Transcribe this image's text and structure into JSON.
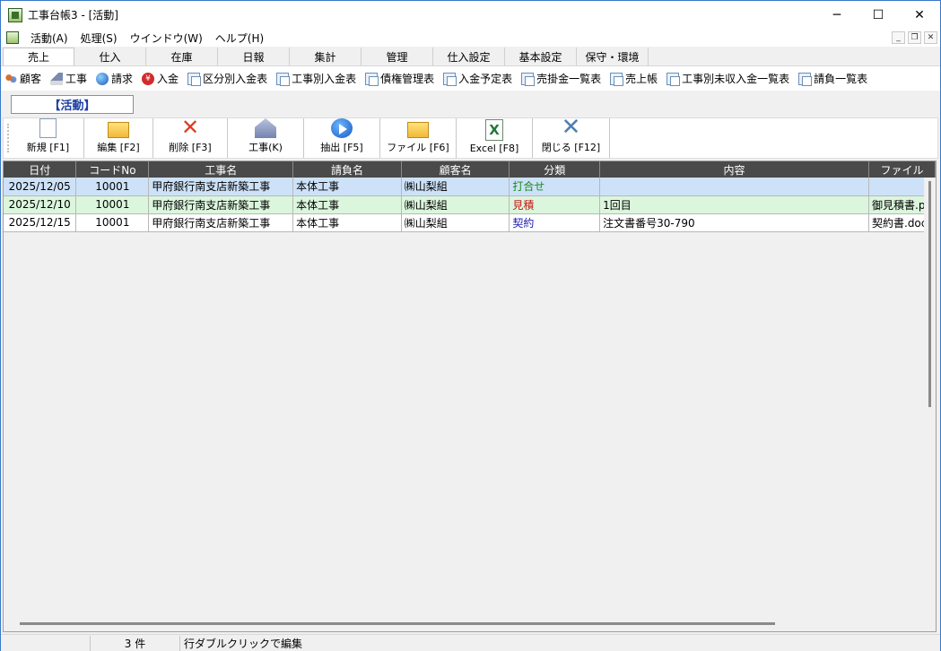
{
  "window": {
    "title": "工事台帳3 - [活動]",
    "minimize": "─",
    "maximize": "☐",
    "close": "✕"
  },
  "menu": [
    {
      "label": "活動(A)"
    },
    {
      "label": "処理(S)"
    },
    {
      "label": "ウインドウ(W)"
    },
    {
      "label": "ヘルプ(H)"
    }
  ],
  "mdi_controls": {
    "minimize": "_",
    "restore": "❐",
    "close": "✕"
  },
  "tabs": [
    {
      "label": "売上"
    },
    {
      "label": "仕入"
    },
    {
      "label": "在庫"
    },
    {
      "label": "日報"
    },
    {
      "label": "集計"
    },
    {
      "label": "管理"
    },
    {
      "label": "仕入設定"
    },
    {
      "label": "基本設定"
    },
    {
      "label": "保守・環境"
    }
  ],
  "subtoolbar": [
    {
      "label": "顧客",
      "icon": "people-icon"
    },
    {
      "label": "工事",
      "icon": "house-icon"
    },
    {
      "label": "請求",
      "icon": "globe-icon"
    },
    {
      "label": "入金",
      "icon": "yen-icon"
    },
    {
      "label": "区分別入金表",
      "icon": "document-icon"
    },
    {
      "label": "工事別入金表",
      "icon": "document-icon"
    },
    {
      "label": "債権管理表",
      "icon": "document-icon"
    },
    {
      "label": "入金予定表",
      "icon": "document-icon"
    },
    {
      "label": "売掛金一覧表",
      "icon": "document-icon"
    },
    {
      "label": "売上帳",
      "icon": "document-icon"
    },
    {
      "label": "工事別未収入金一覧表",
      "icon": "document-icon"
    },
    {
      "label": "請負一覧表",
      "icon": "document-icon"
    }
  ],
  "heading": "【活動】",
  "toolbar": {
    "new": "新規 [F1]",
    "edit": "編集 [F2]",
    "delete": "削除 [F3]",
    "project": "工事(K)",
    "extract": "抽出 [F5]",
    "file": "ファイル [F6]",
    "excel": "Excel [F8]",
    "close": "閉じる [F12]",
    "excel_glyph": "X"
  },
  "grid": {
    "columns": [
      "日付",
      "コードNo",
      "工事名",
      "請負名",
      "顧客名",
      "分類",
      "内容",
      "ファイル"
    ],
    "rows": [
      {
        "date": "2025/12/05",
        "code": "10001",
        "project": "甲府銀行南支店新築工事",
        "contract": "本体工事",
        "customer": "㈱山梨組",
        "category": "打合せ",
        "category_color": "#1a8a1a",
        "content": "",
        "file": ""
      },
      {
        "date": "2025/12/10",
        "code": "10001",
        "project": "甲府銀行南支店新築工事",
        "contract": "本体工事",
        "customer": "㈱山梨組",
        "category": "見積",
        "category_color": "#c81414",
        "content": "1回目",
        "file": "御見積書.p"
      },
      {
        "date": "2025/12/15",
        "code": "10001",
        "project": "甲府銀行南支店新築工事",
        "contract": "本体工事",
        "customer": "㈱山梨組",
        "category": "契約",
        "category_color": "#1c1cb8",
        "content": "注文書番号30-790",
        "file": "契約書.doc"
      }
    ]
  },
  "status": {
    "count": "3 件",
    "hint": "行ダブルクリックで編集"
  }
}
